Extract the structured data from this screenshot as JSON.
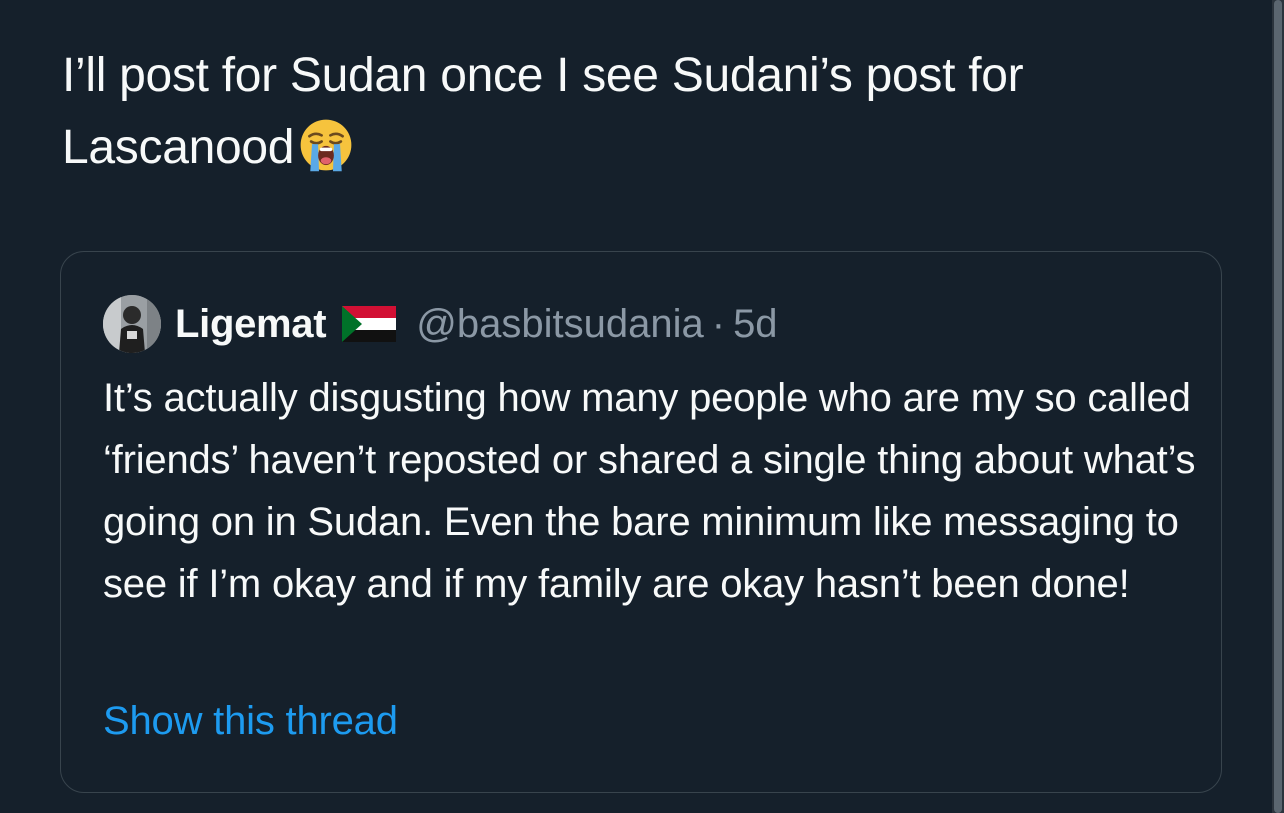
{
  "tweet": {
    "text": "I’ll post for Sudan once I see Sudani’s post for Lascanood",
    "emoji_icon": "loudly-crying-face-icon"
  },
  "quoted_tweet": {
    "display_name": "Ligemat",
    "flag_icon": "sudan-flag-icon",
    "handle": "@basbitsudania",
    "separator": "·",
    "time": "5d",
    "body": "It’s actually disgusting how many people who are my so called ‘friends’ haven’t reposted or shared a single thing about what’s going on in Sudan. Even the bare minimum like messaging to see if I’m okay and if my family are okay hasn’t been done!",
    "show_thread": "Show this thread"
  },
  "colors": {
    "background": "#15202b",
    "text_primary": "#f7f9f9",
    "text_secondary": "#8b98a5",
    "accent": "#1d9bf0",
    "border": "#38444d"
  }
}
